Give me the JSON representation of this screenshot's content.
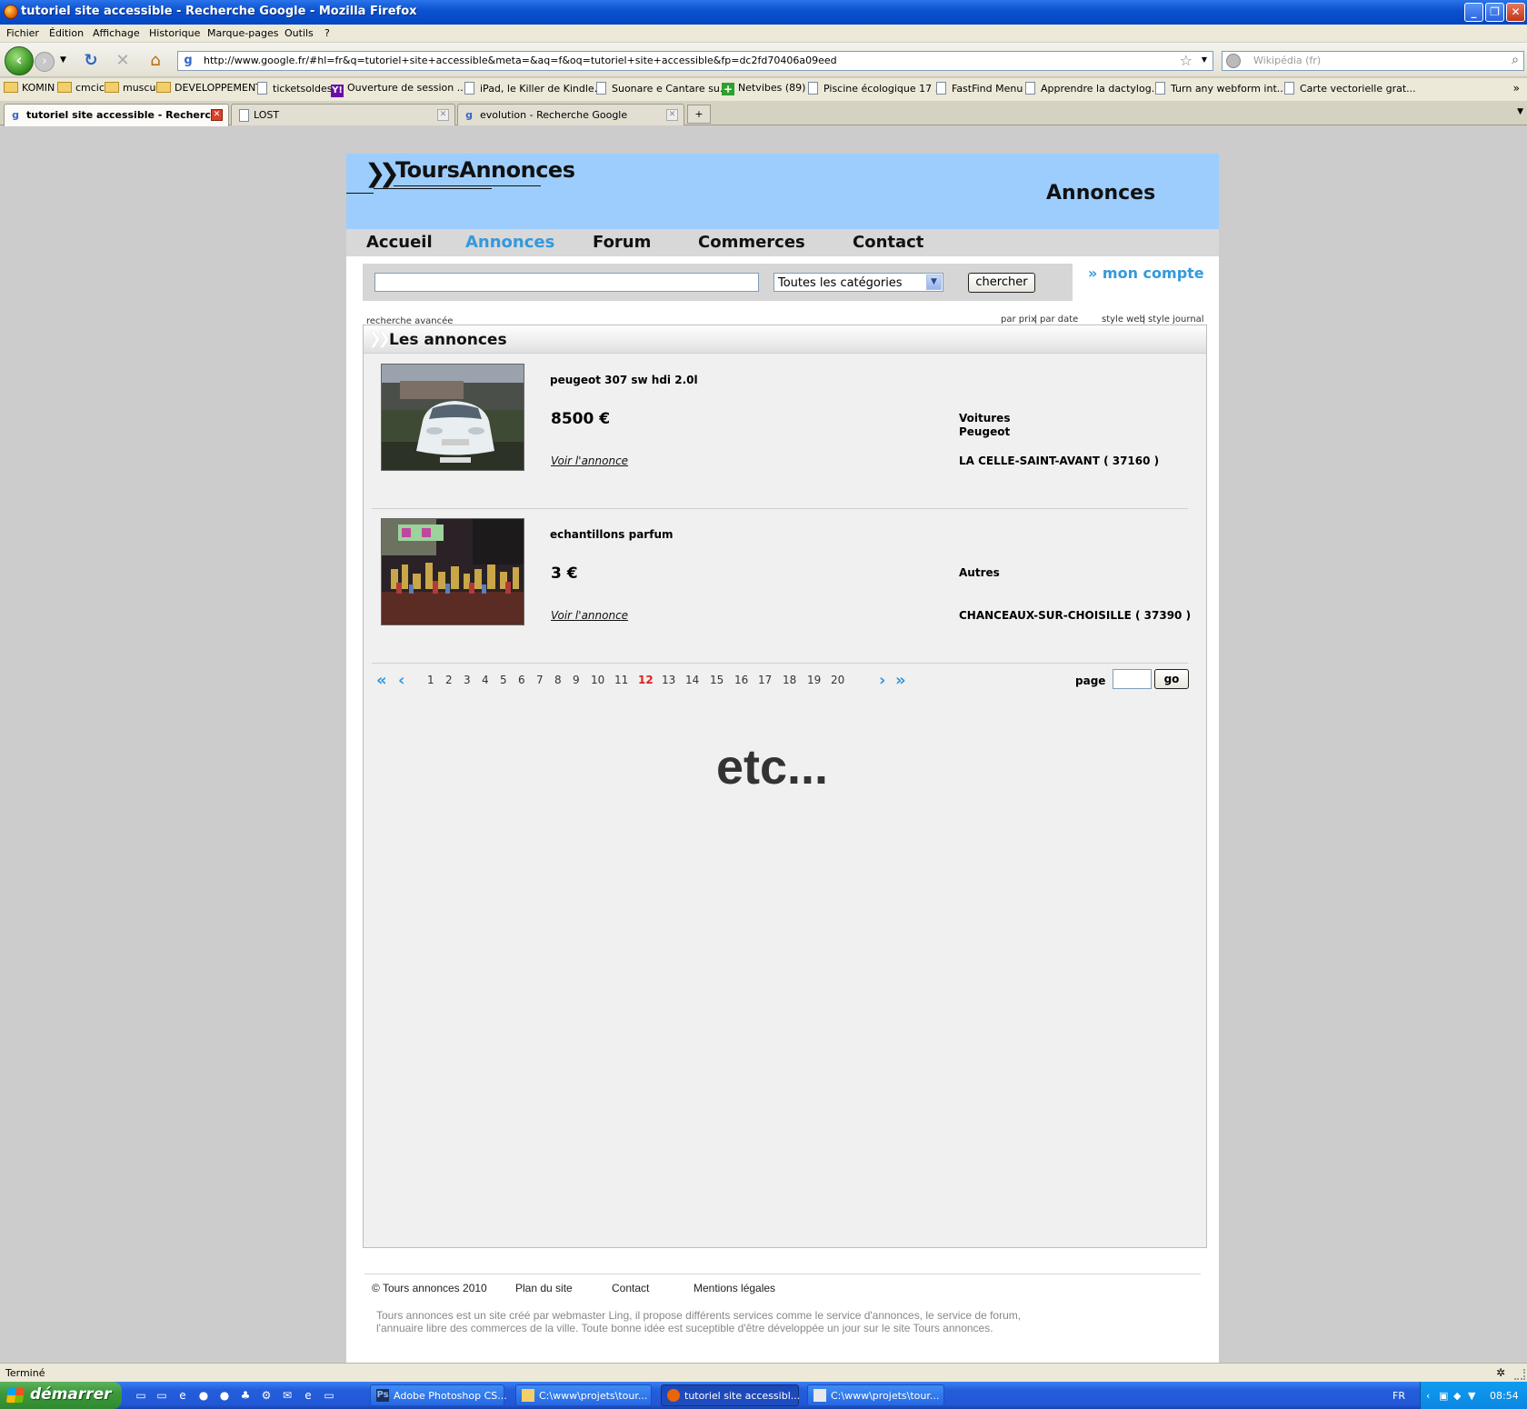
{
  "window": {
    "title": "tutoriel site accessible - Recherche Google - Mozilla Firefox",
    "min": "_",
    "max": "❐",
    "close": "✕"
  },
  "menu": [
    "Fichier",
    "Édition",
    "Affichage",
    "Historique",
    "Marque-pages",
    "Outils",
    "?"
  ],
  "nav": {
    "url": "http://www.google.fr/#hl=fr&q=tutoriel+site+accessible&meta=&aq=f&oq=tutoriel+site+accessible&fp=dc2fd70406a09eed",
    "search_placeholder": "Wikipédia (fr)"
  },
  "bookmarks": [
    {
      "label": "KOMIN",
      "icon": "folder-icon"
    },
    {
      "label": "cmcic",
      "icon": "folder-icon"
    },
    {
      "label": "muscu",
      "icon": "folder-icon"
    },
    {
      "label": "DEVELOPPEMENT",
      "icon": "folder-icon"
    },
    {
      "label": "ticketsoldes",
      "icon": "page-icon"
    },
    {
      "label": "Ouverture de session ...",
      "icon": "yahoo-icon"
    },
    {
      "label": "iPad, le Killer de Kindle...",
      "icon": "page-icon"
    },
    {
      "label": "Suonare e Cantare su...",
      "icon": "page-icon"
    },
    {
      "label": "Netvibes (89)",
      "icon": "netvibes-icon"
    },
    {
      "label": "Piscine écologique 17 ...",
      "icon": "page-icon"
    },
    {
      "label": "FastFind Menu",
      "icon": "page-icon"
    },
    {
      "label": "Apprendre la dactylog...",
      "icon": "page-icon"
    },
    {
      "label": "Turn any webform int...",
      "icon": "page-icon"
    },
    {
      "label": "Carte vectorielle grat...",
      "icon": "page-icon"
    }
  ],
  "tabs": [
    {
      "label": "tutoriel site accessible - Recherc...",
      "active": true
    },
    {
      "label": "LOST",
      "active": false
    },
    {
      "label": "evolution - Recherche Google",
      "active": false
    }
  ],
  "site": {
    "logo": "ToursAnnonces",
    "header_title": "Annonces",
    "nav": [
      "Accueil",
      "Annonces",
      "Forum",
      "Commerces",
      "Contact"
    ],
    "nav_current": "Annonces",
    "search": {
      "category": "Toutes les catégories",
      "button": "chercher",
      "advanced": "recherche avancée"
    },
    "account": "mon compte",
    "sort": {
      "by_price": "par prix",
      "sep": "|",
      "by_date": "par date"
    },
    "style": {
      "web": "style web",
      "sep": "|",
      "journal": "style journal"
    },
    "panel_title": "Les annonces",
    "listings": [
      {
        "title": "peugeot 307 sw hdi 2.0l",
        "price": "8500 €",
        "link": "Voir l'annonce",
        "category": "Voitures",
        "subcategory": "Peugeot",
        "location": "LA CELLE-SAINT-AVANT ( 37160 )"
      },
      {
        "title": "echantillons parfum",
        "price": "3 €",
        "link": "Voir l'annonce",
        "category": "Autres",
        "subcategory": "",
        "location": "CHANCEAUX-SUR-CHOISILLE ( 37390 )"
      }
    ],
    "pagination": {
      "first": "«",
      "prev": "‹",
      "next": "›",
      "last": "»",
      "pages": [
        "1",
        "2",
        "3",
        "4",
        "5",
        "6",
        "7",
        "8",
        "9",
        "10",
        "11",
        "12",
        "13",
        "14",
        "15",
        "16",
        "17",
        "18",
        "19",
        "20"
      ],
      "current": "12",
      "page_label": "page",
      "go": "go"
    },
    "etc": "etc...",
    "footer": {
      "copyright": "© Tours annonces 2010",
      "plan": "Plan du site",
      "contact": "Contact",
      "legal": "Mentions légales",
      "description": "Tours annonces est un site créé par webmaster Ling, il propose différents services comme le service d'annonces, le service de forum, l'annuaire libre des commerces de la ville. Toute bonne idée est suceptible d'être développée un jour sur le site Tours annonces."
    }
  },
  "status": "Terminé",
  "taskbar": {
    "start": "démarrer",
    "tasks": [
      {
        "label": "Adobe Photoshop CS...",
        "active": false
      },
      {
        "label": "C:\\www\\projets\\tour...",
        "active": false
      },
      {
        "label": "tutoriel site accessibl...",
        "active": true
      },
      {
        "label": "C:\\www\\projets\\tour...",
        "active": false
      }
    ],
    "lang": "FR",
    "time": "08:54"
  }
}
